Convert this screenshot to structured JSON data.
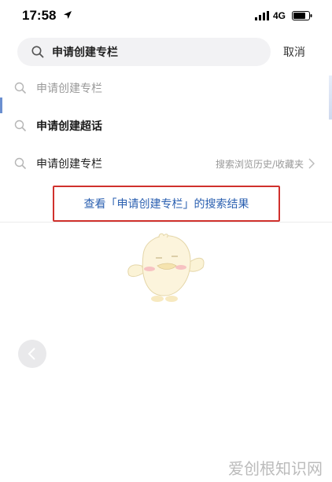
{
  "status_bar": {
    "time": "17:58",
    "network": "4G"
  },
  "search": {
    "value": "申请创建专栏",
    "cancel_label": "取消"
  },
  "suggestions": [
    {
      "text": "申请创建专栏",
      "style": "dim"
    },
    {
      "text": "申请创建超话",
      "style": "bold"
    },
    {
      "text": "申请创建专栏",
      "hint": "搜索浏览历史/收藏夹"
    }
  ],
  "result_link": "查看「申请创建专栏」的搜索结果",
  "watermark": "爱创根知识网",
  "colors": {
    "link": "#2a5fb0",
    "highlight_border": "#d0312d",
    "search_bg": "#f2f2f4"
  }
}
